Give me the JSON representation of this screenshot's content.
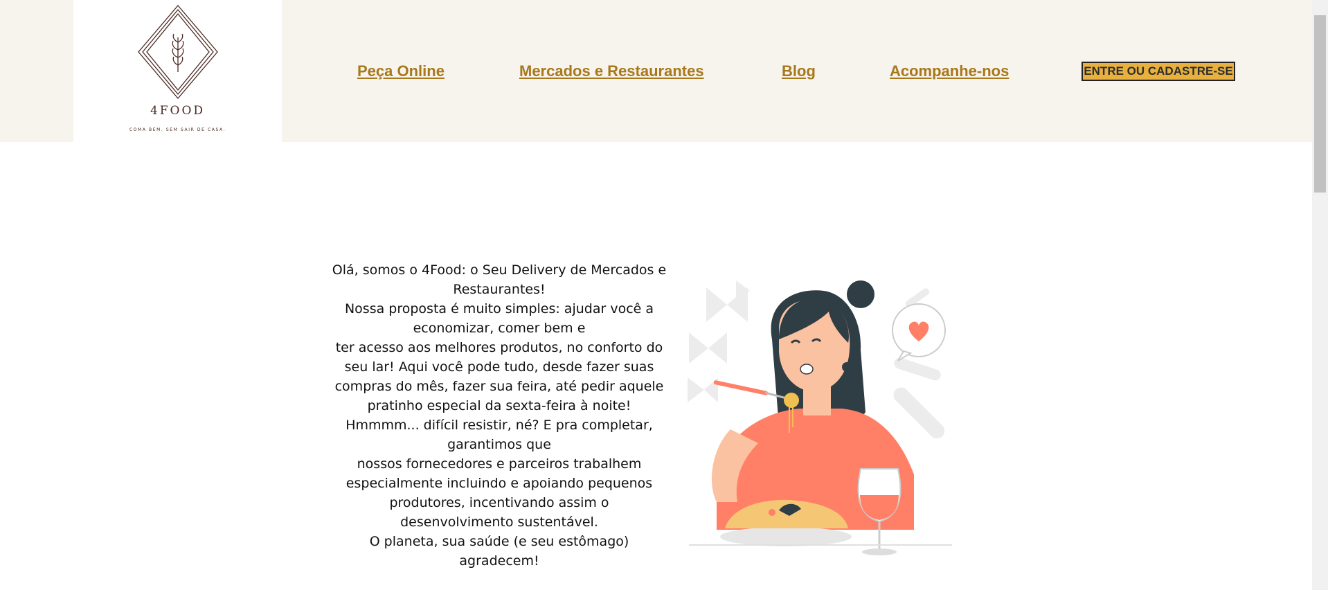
{
  "brand": {
    "name": "4FOOD",
    "tagline": "COMA BEM. SEM SAIR DE CASA.",
    "logo_icon": "wheat-diamond-logo"
  },
  "nav": {
    "items": [
      {
        "label": "Peça Online"
      },
      {
        "label": "Mercados e Restaurantes"
      },
      {
        "label": "Blog"
      },
      {
        "label": "Acompanhe-nos"
      }
    ],
    "cta_label": "ENTRE OU CADASTRE-SE"
  },
  "intro": {
    "lines": [
      "Olá, somos o 4Food: o Seu Delivery de Mercados e Restaurantes!",
      "Nossa proposta é muito simples: ajudar você a economizar, comer bem e",
      "ter acesso aos melhores produtos, no conforto do seu lar! Aqui você pode tudo, desde fazer suas compras do mês, fazer sua feira, até pedir aquele pratinho especial da sexta-feira à noite! Hmmmm... difícil resistir, né? E pra completar, garantimos que",
      "nossos fornecedores e parceiros trabalhem especialmente incluindo e apoiando pequenos produtores, incentivando assim o desenvolvimento sustentável.",
      "O planeta, sua saúde (e seu estômago) agradecem!"
    ]
  },
  "illustration": {
    "icon": "woman-eating-pasta-illustration"
  },
  "colors": {
    "header_bg": "#f7f3ed",
    "link": "#a8781a",
    "cta_bg": "#e8b13f",
    "accent": "#ff8066",
    "hair": "#2f3d44"
  }
}
